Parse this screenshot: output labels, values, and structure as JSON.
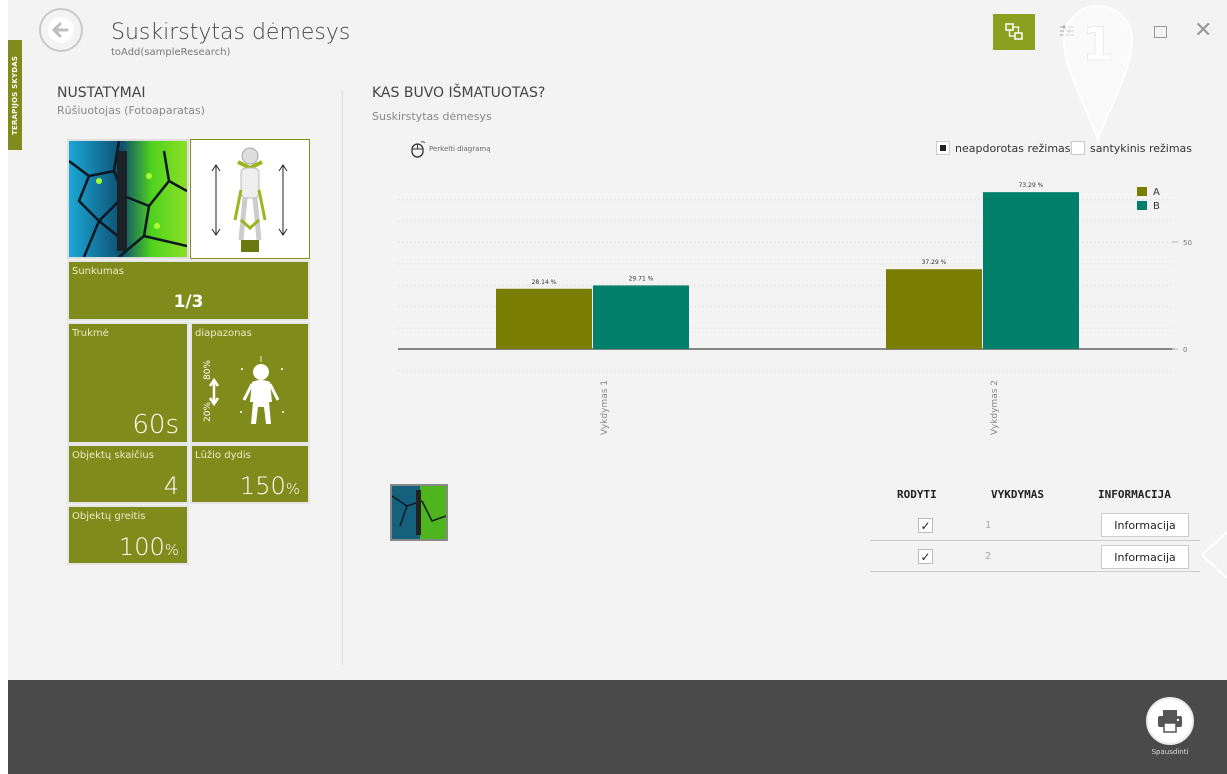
{
  "side_tab": "TERAPIJOS SKYDAS",
  "header": {
    "title": "Suskirstytas dėmesys",
    "subtitle": "toAdd(sampleResearch)",
    "pin_number": "1"
  },
  "settings": {
    "title": "NUSTATYMAI",
    "subtitle": "Rūšiuotojas  (Fotoaparatas)",
    "difficulty_label": "Sunkumas",
    "difficulty_value": "1/3",
    "duration_label": "Trukmė",
    "duration_value": "60",
    "duration_unit": "s",
    "range_label": "diapazonas",
    "range_low": "20%",
    "range_high": "80%",
    "objects_label": "Objektų skaičius",
    "objects_value": "4",
    "break_label": "Lūžio dydis",
    "break_value": "150",
    "break_unit": "%",
    "speed_label": "Objektų greitis",
    "speed_value": "100",
    "speed_unit": "%"
  },
  "measured": {
    "title": "KAS BUVO IŠMATUOTAS?",
    "subtitle": "Suskirstytas dėmesys",
    "move_chart": "Perkelti diagramą",
    "mode_raw": "neapdorotas režimas",
    "mode_relative": "santykinis režimas"
  },
  "colors": {
    "accent": "#7f8c1b",
    "series_a": "#7a7e00",
    "series_b": "#00806a",
    "bottom_bar": "#4a4a4a"
  },
  "chart_data": {
    "type": "bar",
    "categories": [
      "Vykdymas 1",
      "Vykdymas 2"
    ],
    "series": [
      {
        "name": "A",
        "values": [
          28.14,
          37.29
        ],
        "labels": [
          "28.14 %",
          "37.29 %"
        ]
      },
      {
        "name": "B",
        "values": [
          29.71,
          73.29
        ],
        "labels": [
          "29.71 %",
          "73.29 %"
        ]
      }
    ],
    "yticks": [
      "0",
      "50"
    ],
    "ylim": [
      0,
      75
    ],
    "legend": "top-right",
    "grid": true
  },
  "table": {
    "headers": [
      "RODYTI",
      "VYKDYMAS",
      "INFORMACIJA"
    ],
    "rows": [
      {
        "run": "1",
        "info": "Informacija"
      },
      {
        "run": "2",
        "info": "Informacija"
      }
    ]
  },
  "footer": {
    "print_label": "Spausdinti"
  },
  "icons": {
    "back": "arrow-left-icon",
    "top_button": "network-icon",
    "tune": "sliders-icon",
    "maximize": "maximize-icon",
    "close": "close-icon",
    "mouse": "mouse-icon",
    "print": "printer-icon"
  }
}
